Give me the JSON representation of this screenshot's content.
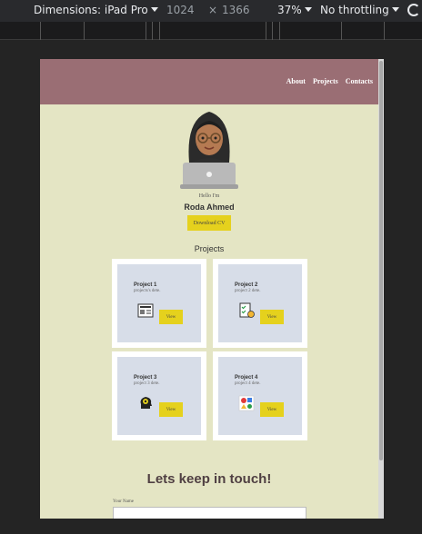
{
  "devtools": {
    "device": "Dimensions: iPad Pro",
    "width": "1024",
    "times": "×",
    "height": "1366",
    "zoom": "37%",
    "throttle": "No throttling"
  },
  "site": {
    "nav": [
      "About",
      "Projects",
      "Contacts"
    ],
    "hello": "Hello I'm",
    "name": "Roda Ahmed",
    "cv_button": "Download CV",
    "projects_title": "Projects",
    "projects": [
      {
        "title": "Project 1",
        "desc": "projects's dete.",
        "button": "View",
        "icon": "newspaper-icon"
      },
      {
        "title": "Project 2",
        "desc": "project 2 dete.",
        "button": "View",
        "icon": "checklist-icon"
      },
      {
        "title": "Project 3",
        "desc": "project 3 dete.",
        "button": "View",
        "icon": "gear-head-icon"
      },
      {
        "title": "Project 4",
        "desc": "project 4 dete.",
        "button": "View",
        "icon": "shapes-icon"
      }
    ],
    "touch_title": "Lets keep in touch!",
    "name_label": "Your Name"
  },
  "colors": {
    "header": "#9a6e74",
    "background": "#e4e5c4",
    "button": "#e5d11d",
    "card": "#d7dde8"
  }
}
